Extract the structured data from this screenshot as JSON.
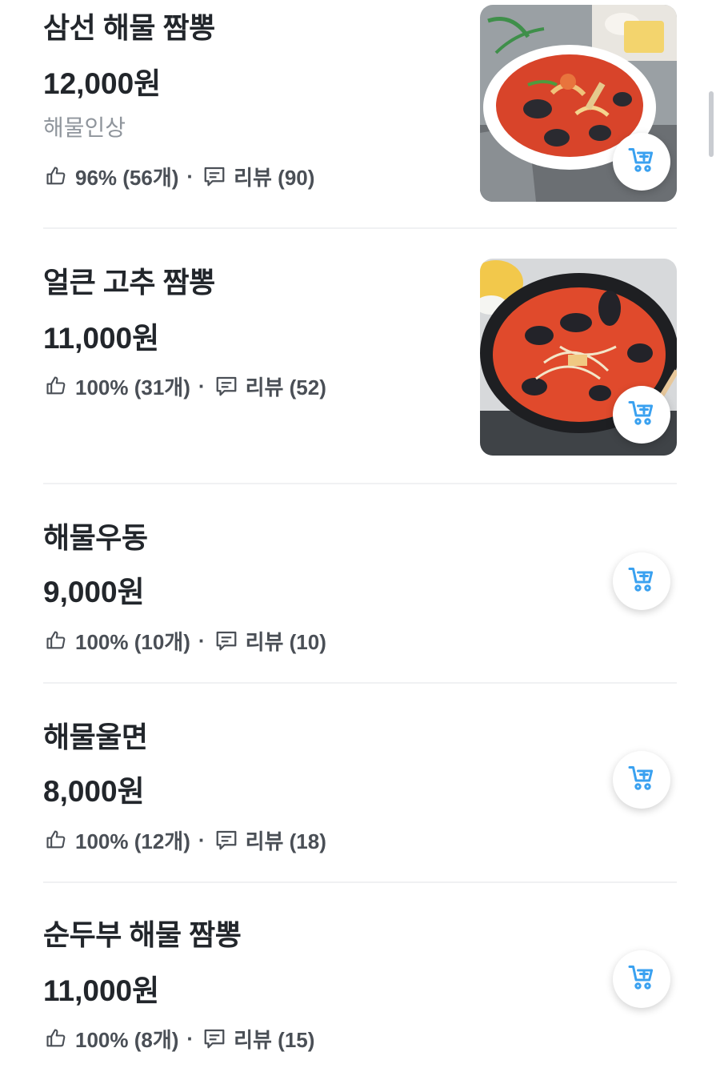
{
  "menu": {
    "items": [
      {
        "name": "삼선 해물 짬뽕",
        "price": "12,000원",
        "description": "해물인상",
        "like_rate": "96% (56개)",
        "review": "리뷰 (90)",
        "has_image": true
      },
      {
        "name": "얼큰 고추 짬뽕",
        "price": "11,000원",
        "like_rate": "100% (31개)",
        "review": "리뷰 (52)",
        "has_image": true
      },
      {
        "name": "해물우동",
        "price": "9,000원",
        "like_rate": "100% (10개)",
        "review": "리뷰 (10)",
        "has_image": false
      },
      {
        "name": "해물울면",
        "price": "8,000원",
        "like_rate": "100% (12개)",
        "review": "리뷰 (18)",
        "has_image": false
      },
      {
        "name": "순두부 해물 짬뽕",
        "price": "11,000원",
        "like_rate": "100% (8개)",
        "review": "리뷰 (15)",
        "has_image": false
      }
    ],
    "separator": "·",
    "icons": {
      "like": "thumbs-up-icon",
      "review": "speech-bubble-icon",
      "cart": "cart-add-icon"
    }
  },
  "colors": {
    "cart_accent": "#3aa1f0",
    "text_primary": "#22262b",
    "text_secondary": "#8f959c",
    "divider": "#f0f1f3"
  }
}
